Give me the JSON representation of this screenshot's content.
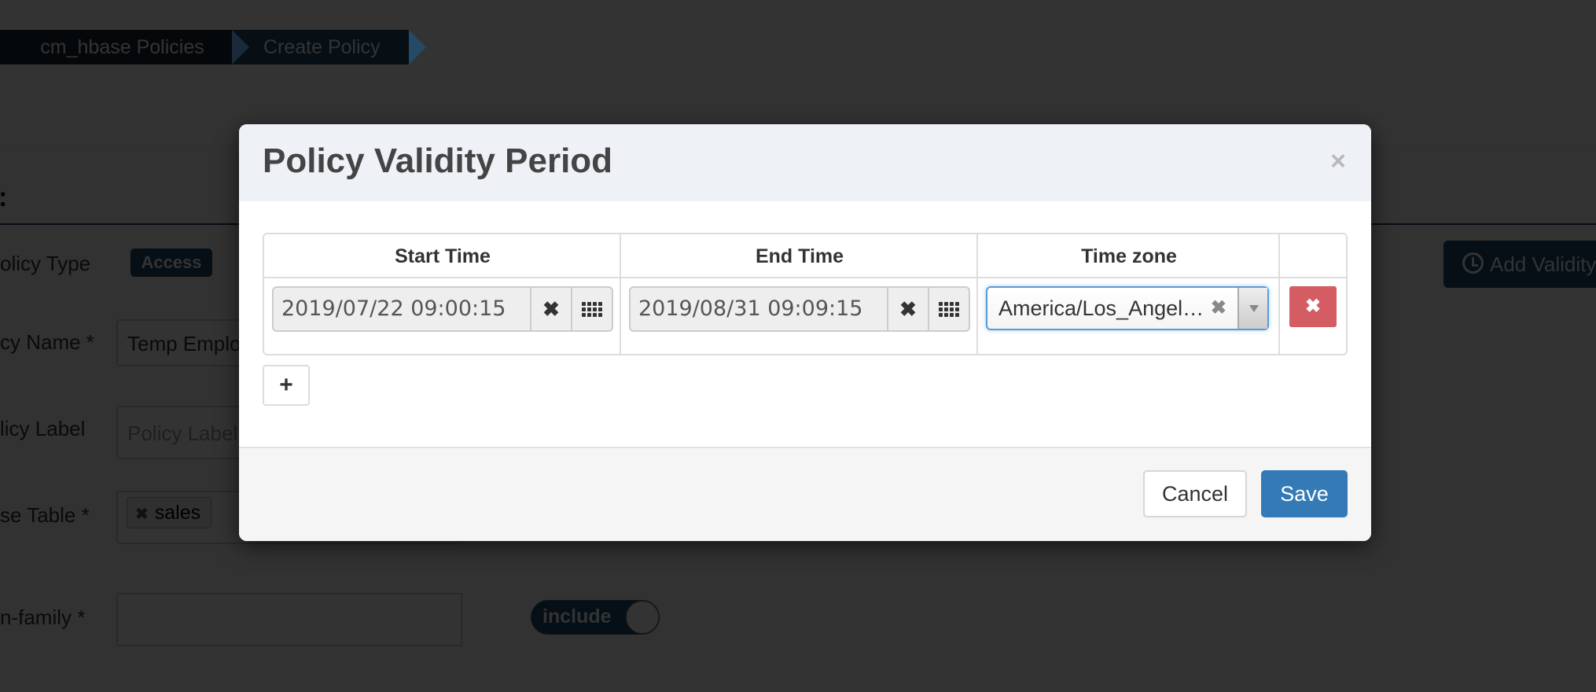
{
  "breadcrumb": {
    "items": [
      {
        "label": "cm_hbase Policies"
      },
      {
        "label": "Create Policy"
      }
    ]
  },
  "form": {
    "policy_type_label": "olicy Type",
    "policy_type_badge": "Access",
    "policy_name_label": "cy Name *",
    "policy_name_value": "Temp Emplo",
    "policy_label_label": "licy Label",
    "policy_label_placeholder": "Policy Label",
    "table_label": "se Table *",
    "table_tags": [
      "sales"
    ],
    "column_family_label": "n-family *",
    "include_toggle_label": "include",
    "add_validity_label": "Add Validity"
  },
  "modal": {
    "title": "Policy Validity Period",
    "close_icon": "×",
    "table": {
      "headers": [
        "Start Time",
        "End Time",
        "Time zone"
      ],
      "rows": [
        {
          "start_time": "2019/07/22 09:00:15",
          "end_time": "2019/08/31 09:09:15",
          "time_zone": "America/Los_Angel…"
        }
      ]
    },
    "add_row_label": "+",
    "cancel_label": "Cancel",
    "save_label": "Save",
    "colors": {
      "save": "#337ab7",
      "delete": "#d35d62",
      "focus": "#5b9bd5"
    }
  }
}
